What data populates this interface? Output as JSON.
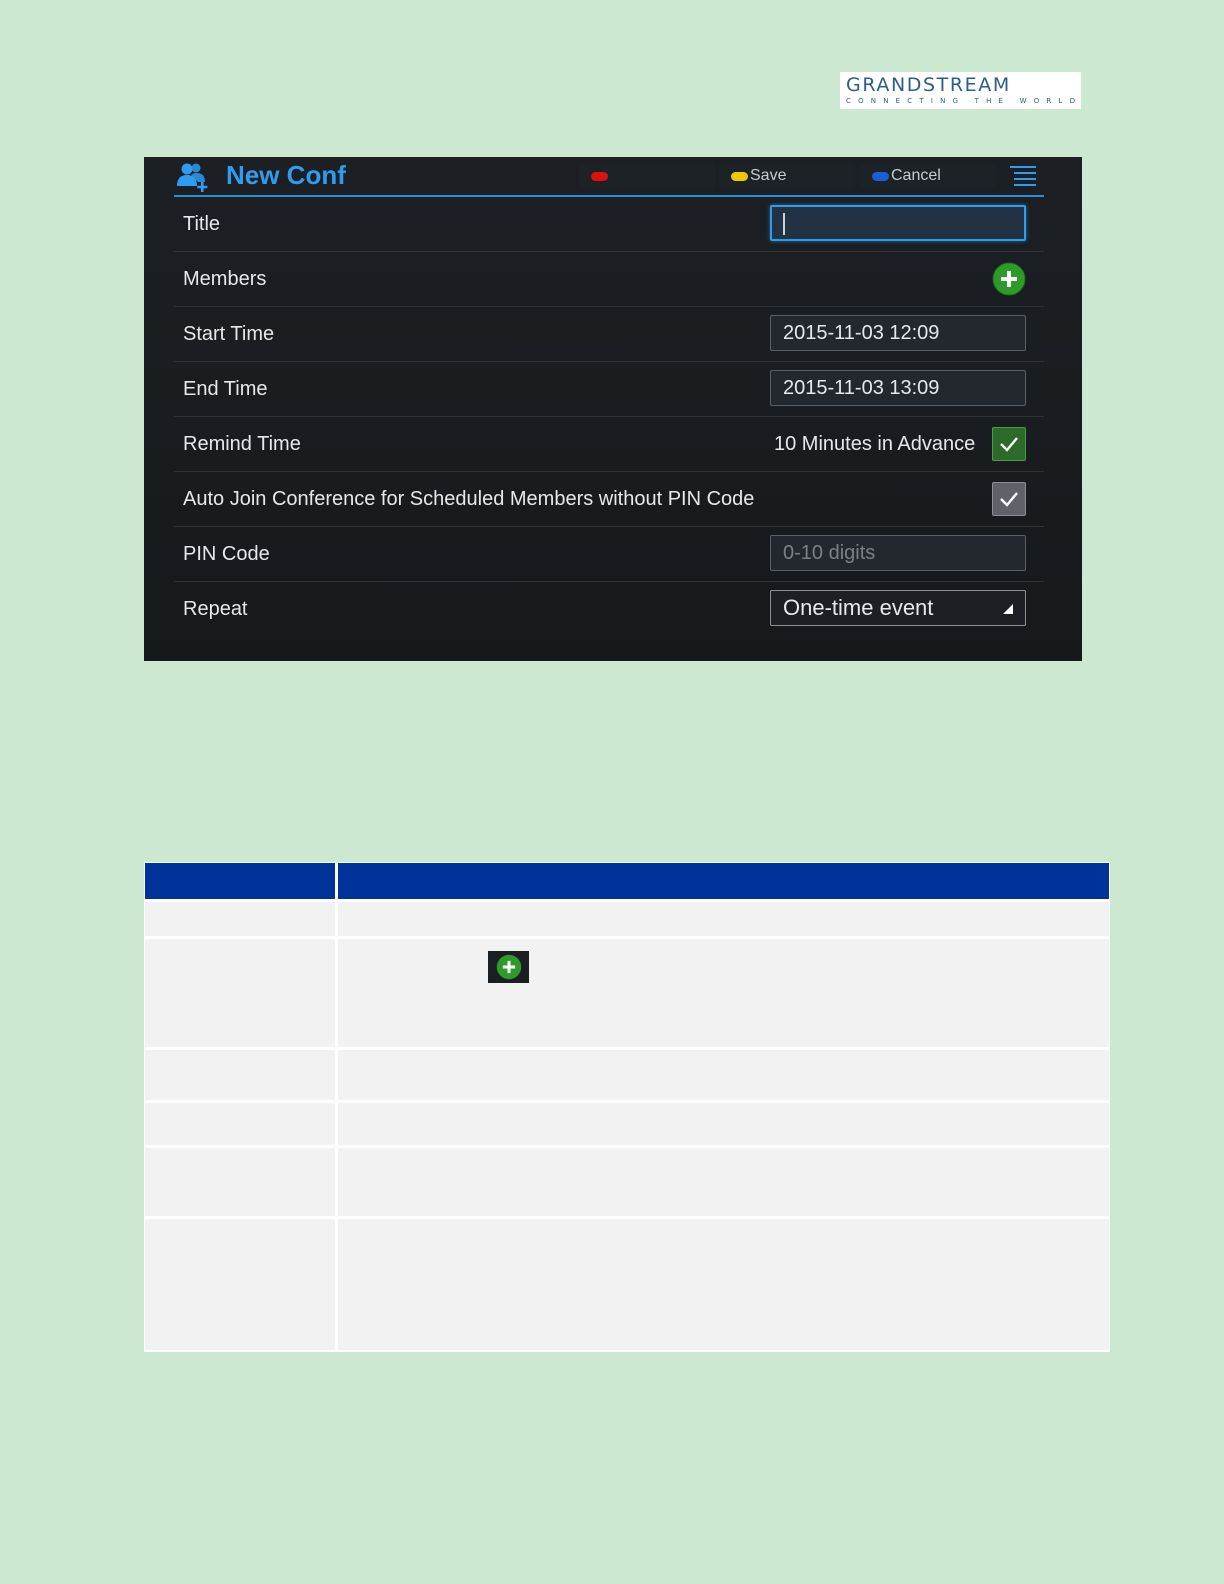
{
  "logo": {
    "name": "GRANDSTREAM",
    "tagline": "CONNECTING THE WORLD"
  },
  "screen": {
    "title": "New Conf",
    "softkeys": [
      {
        "color": "#e01010",
        "label": ""
      },
      {
        "color": "#f0c800",
        "label": "Save"
      },
      {
        "color": "#1a5fd8",
        "label": "Cancel"
      }
    ],
    "rows": {
      "title": {
        "label": "Title",
        "value": ""
      },
      "members": {
        "label": "Members"
      },
      "start_time": {
        "label": "Start Time",
        "value": "2015-11-03 12:09"
      },
      "end_time": {
        "label": "End Time",
        "value": "2015-11-03 13:09"
      },
      "remind_time": {
        "label": "Remind Time",
        "value": "10 Minutes in Advance",
        "checked": true
      },
      "auto_join": {
        "label": "Auto Join Conference for Scheduled Members without PIN Code",
        "checked": true
      },
      "pin_code": {
        "label": "PIN Code",
        "placeholder": "0-10 digits"
      },
      "repeat": {
        "label": "Repeat",
        "value": "One-time event"
      }
    }
  },
  "colors": {
    "accent": "#2f9cf0",
    "table_header": "#003399",
    "page_background": "#cde8d0"
  }
}
